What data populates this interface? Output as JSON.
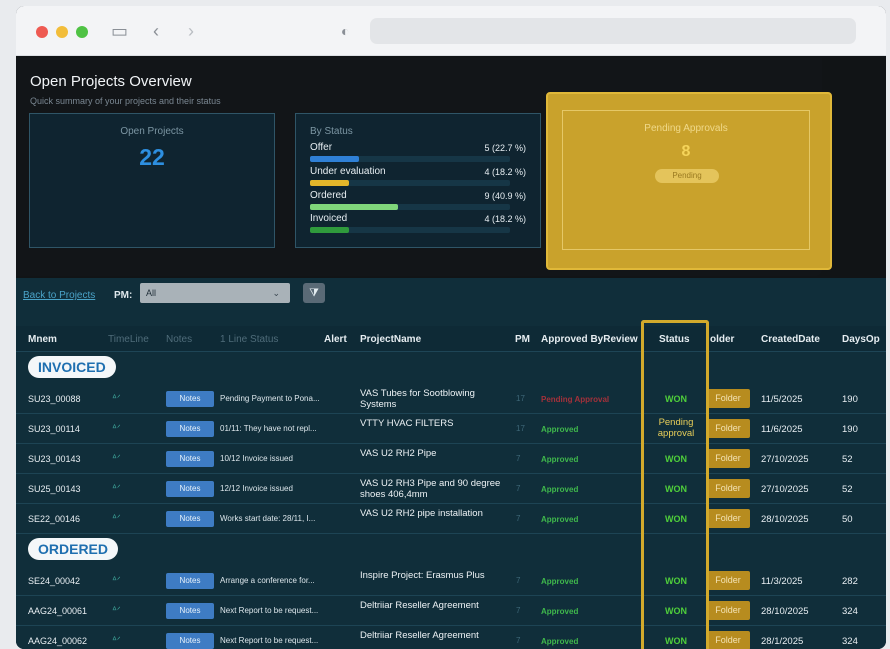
{
  "window": {
    "url": ""
  },
  "hero": {
    "title": "Open Projects Overview",
    "subtitle": "Quick summary of your projects and their status",
    "open_projects": {
      "label": "Open Projects",
      "value": "22"
    },
    "by_status": {
      "title": "By Status",
      "items": [
        {
          "label": "Offer",
          "value": "5 (22.7 %)",
          "fraction": 0.227,
          "color": "#2f80d6"
        },
        {
          "label": "Under evaluation",
          "value": "4 (18.2 %)",
          "fraction": 0.182,
          "color": "#e4b62a"
        },
        {
          "label": "Ordered",
          "value": "9 (40.9 %)",
          "fraction": 0.409,
          "color": "#7fd67a"
        },
        {
          "label": "Invoiced",
          "value": "4 (18.2 %)",
          "fraction": 0.182,
          "color": "#2f9a3c"
        }
      ]
    },
    "pending": {
      "title": "Pending Approvals",
      "value": "8",
      "badge": "Pending"
    }
  },
  "filters": {
    "back_link": "Back to Projects",
    "pm_label": "PM:",
    "pm_value": "All",
    "filter_icon": "filter-icon"
  },
  "table": {
    "headers": {
      "mnem": "Mnem",
      "timeline": "TimeLine",
      "notes": "Notes",
      "line_status": "1 Line Status",
      "alert": "Alert",
      "project_name": "ProjectName",
      "pm": "PM",
      "approved_by": "Approved ByReview",
      "status": "Status",
      "folder": "older",
      "created": "CreatedDate",
      "days": "DaysOp"
    },
    "groups": [
      {
        "label": "INVOICED",
        "rows": [
          {
            "mnem": "SU23_00088",
            "timeline": "ᐞᐟ",
            "notes": "Notes",
            "line": "Pending Payment to Pona...",
            "project": "VAS Tubes for Sootblowing Systems",
            "pm": "17",
            "approval": "Pending Approval",
            "approval_kind": "pending",
            "status": "WON",
            "folder": "Folder",
            "created": "11/5/2025",
            "days": "190"
          },
          {
            "mnem": "SU23_00114",
            "timeline": "ᐞᐟ",
            "notes": "Notes",
            "line": "01/11: They have not repl...",
            "project": "VTTY HVAC FILTERS",
            "pm": "17",
            "approval": "Approved",
            "approval_kind": "ok",
            "status": "Pending approval",
            "status_kind": "pending",
            "folder": "Folder",
            "created": "11/6/2025",
            "days": "190"
          },
          {
            "mnem": "SU23_00143",
            "timeline": "ᐞᐟ",
            "notes": "Notes",
            "line": "10/12 Invoice issued",
            "project": "VAS U2 RH2 Pipe",
            "pm": "7",
            "approval": "Approved",
            "approval_kind": "ok",
            "status": "WON",
            "folder": "Folder",
            "created": "27/10/2025",
            "days": "52"
          },
          {
            "mnem": "SU25_00143",
            "timeline": "ᐞᐟ",
            "notes": "Notes",
            "line": "12/12 Invoice issued",
            "project": "VAS U2 RH3 Pipe and 90 degree shoes 406,4mm",
            "pm": "7",
            "approval": "Approved",
            "approval_kind": "ok",
            "status": "WON",
            "folder": "Folder",
            "created": "27/10/2025",
            "days": "52"
          },
          {
            "mnem": "SE22_00146",
            "timeline": "ᐞᐟ",
            "notes": "Notes",
            "line": "Works start date: 28/11, I...",
            "project": "VAS U2 RH2 pipe installation",
            "pm": "7",
            "approval": "Approved",
            "approval_kind": "ok",
            "status": "WON",
            "folder": "Folder",
            "created": "28/10/2025",
            "days": "50"
          }
        ]
      },
      {
        "label": "ORDERED",
        "rows": [
          {
            "mnem": "SE24_00042",
            "timeline": "ᐞᐟ",
            "notes": "Notes",
            "line": "Arrange a conference for...",
            "project": "Inspire Project: Erasmus Plus",
            "pm": "7",
            "approval": "Approved",
            "approval_kind": "ok",
            "status": "WON",
            "folder": "Folder",
            "created": "11/3/2025",
            "days": "282"
          },
          {
            "mnem": "AAG24_00061",
            "timeline": "ᐞᐟ",
            "notes": "Notes",
            "line": "Next Report to be request...",
            "project": "Deltriiar Reseller Agreement",
            "pm": "7",
            "approval": "Approved",
            "approval_kind": "ok",
            "status": "WON",
            "folder": "Folder",
            "created": "28/10/2025",
            "days": "324"
          },
          {
            "mnem": "AAG24_00062",
            "timeline": "ᐞᐟ",
            "notes": "Notes",
            "line": "Next Report to be request...",
            "project": "Deltriiar Reseller Agreement",
            "pm": "7",
            "approval": "Approved",
            "approval_kind": "ok",
            "status": "WON",
            "folder": "Folder",
            "created": "28/1/2025",
            "days": "324"
          }
        ]
      }
    ]
  }
}
